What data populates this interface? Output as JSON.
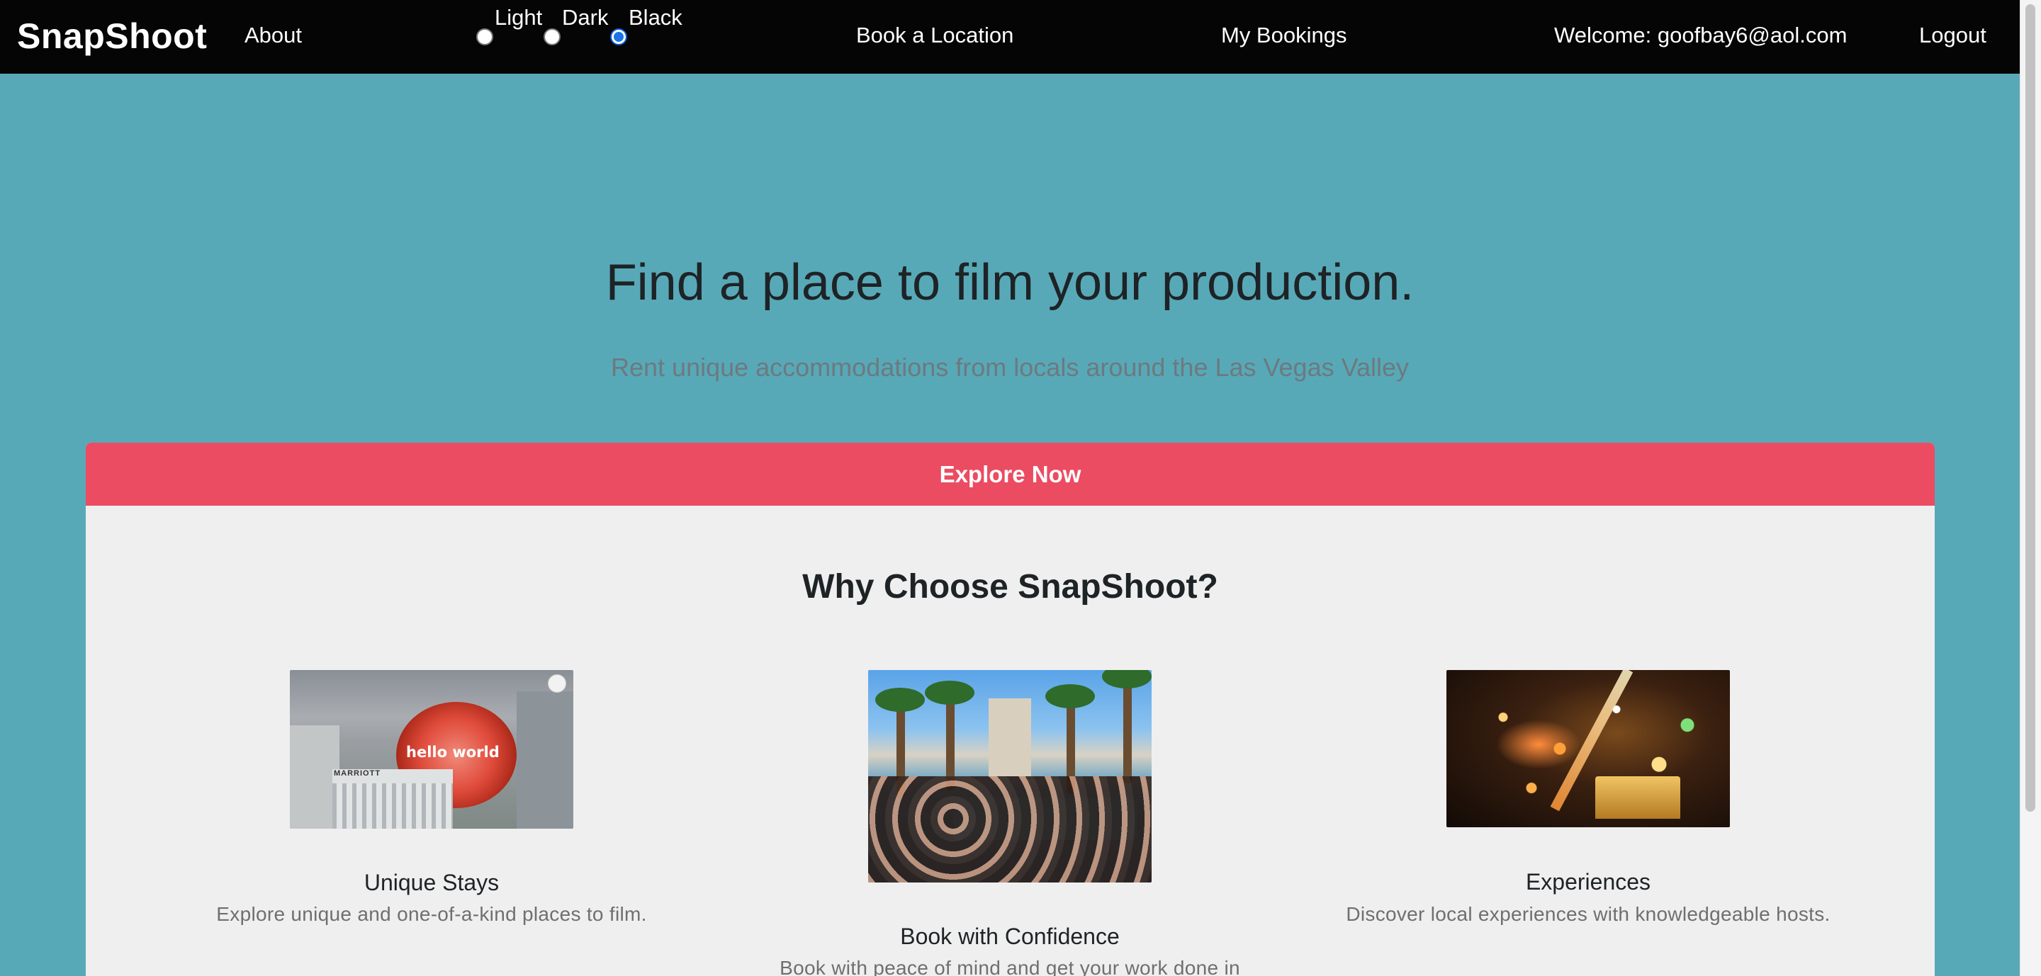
{
  "navbar": {
    "brand": "SnapShoot",
    "about": "About",
    "theme": {
      "options": [
        "Light",
        "Dark",
        "Black"
      ],
      "selected": "Black"
    },
    "book_location": "Book a Location",
    "my_bookings": "My Bookings",
    "welcome": "Welcome: goofbay6@aol.com",
    "logout": "Logout"
  },
  "hero": {
    "title": "Find a place to film your production.",
    "subtitle": "Rent unique accommodations from locals around the Las Vegas Valley"
  },
  "card": {
    "explore_button": "Explore Now",
    "heading": "Why Choose SnapShoot?",
    "features": [
      {
        "title": "Unique Stays",
        "description": "Explore unique and one-of-a-kind places to film.",
        "image_text": "hello world",
        "image_sign": "MARRIOTT"
      },
      {
        "title": "Book with Confidence",
        "description": "Book with peace of mind and get your work done in"
      },
      {
        "title": "Experiences",
        "description": "Discover local experiences with knowledgeable hosts."
      }
    ]
  },
  "colors": {
    "page_background": "#58a9b8",
    "navbar_background": "#050505",
    "explore_button": "#eb4c62",
    "card_background": "#efefef"
  }
}
